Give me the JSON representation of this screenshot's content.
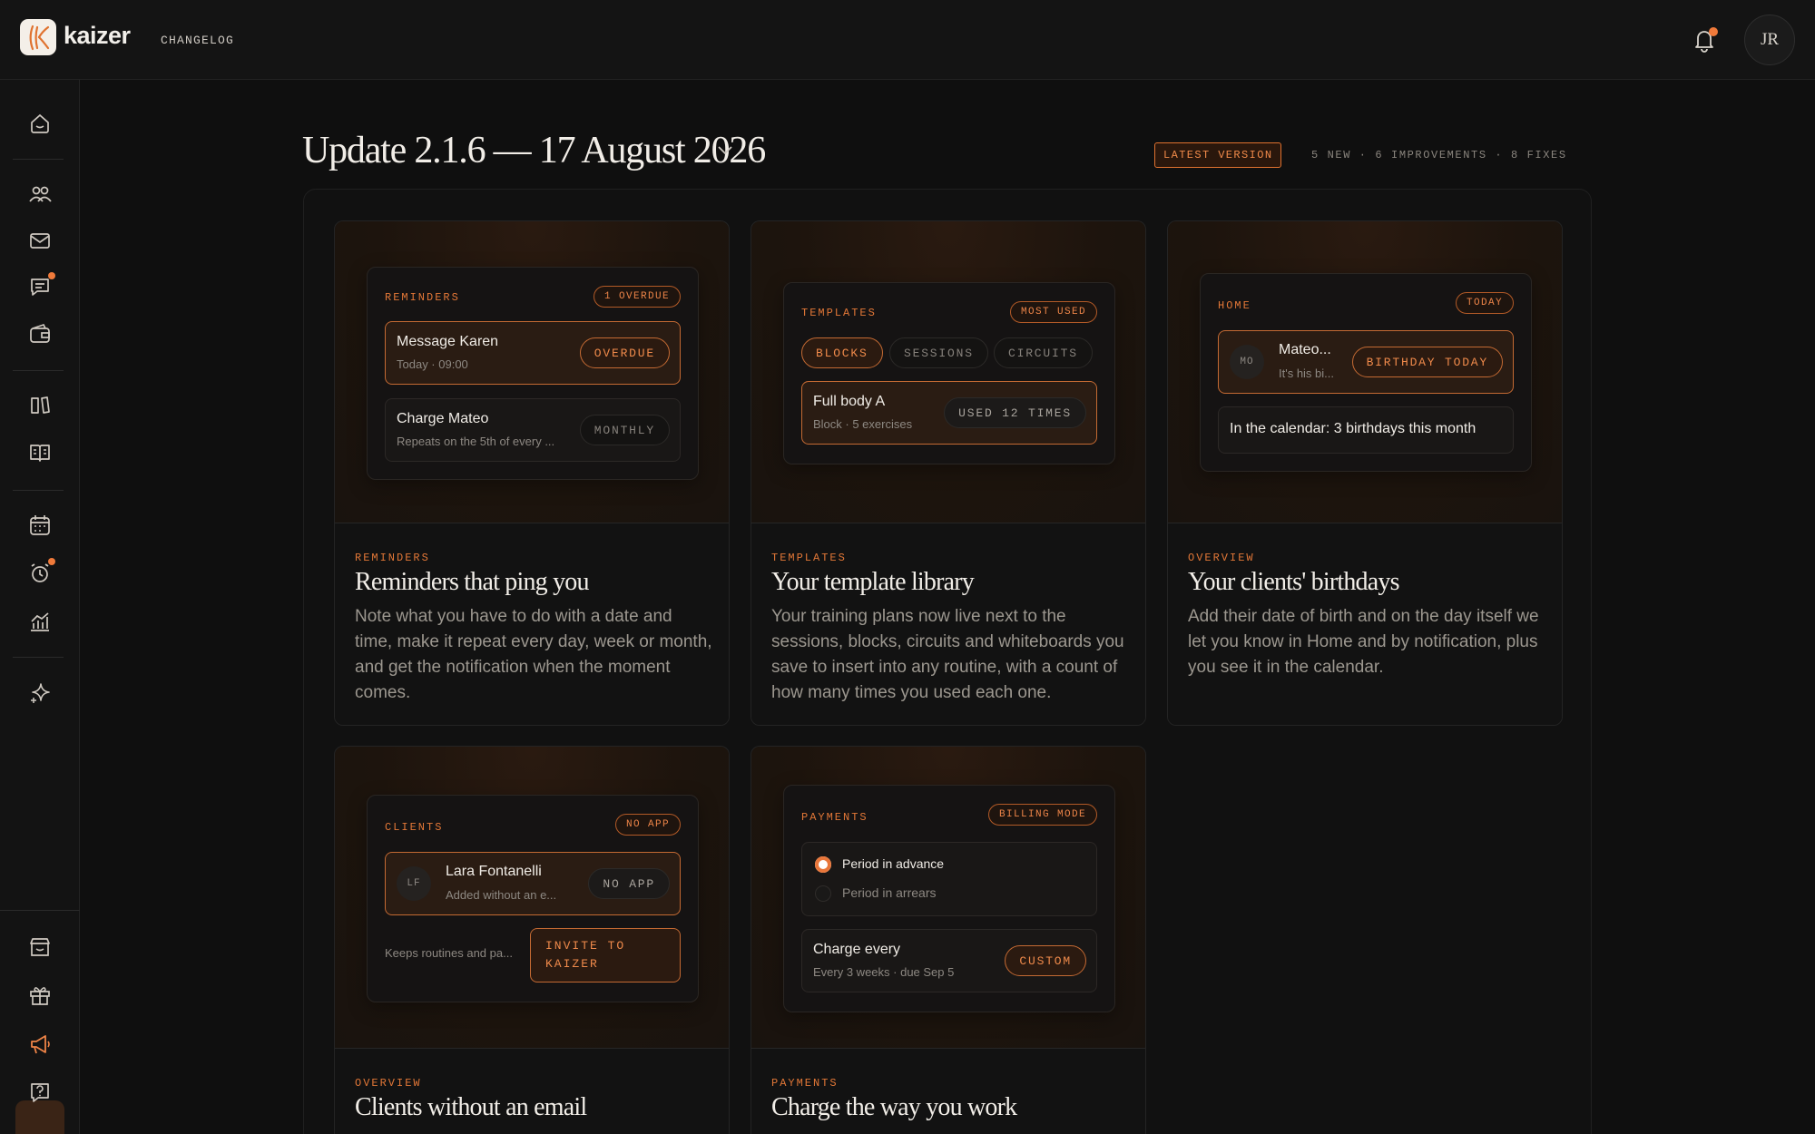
{
  "app": {
    "name": "kaizer",
    "breadcrumb": "CHANGELOG",
    "user_initials": "JR"
  },
  "icons": {
    "sidebar": [
      "home-icon",
      "clients-icon",
      "mail-icon",
      "chat-icon",
      "wallet-icon",
      "library-icon",
      "book-icon",
      "calendar-icon",
      "alarm-icon",
      "stats-icon",
      "sparkle-icon",
      "store-icon",
      "gift-icon",
      "megaphone-icon",
      "help-icon"
    ],
    "top": [
      "bell-icon",
      "chevron-down-icon"
    ]
  },
  "colors": {
    "accent": "#e27737",
    "background": "#0f0f0f",
    "panel": "#151313"
  },
  "header": {
    "title": "Update 2.1.6 — 17 August 2026",
    "latest_badge": "LATEST VERSION",
    "stats": "5 NEW · 6 IMPROVEMENTS · 8 FIXES"
  },
  "cards": [
    {
      "eyebrow": "REMINDERS",
      "title": "Reminders that ping you",
      "description": "Note what you have to do with a date and time, make it repeat every day, week or month, and get the notification when the moment comes.",
      "preview": {
        "label": "REMINDERS",
        "tag": "1 OVERDUE",
        "items": [
          {
            "title": "Message Karen",
            "sub": "Today · 09:00",
            "pill": "OVERDUE"
          },
          {
            "title": "Charge Mateo",
            "sub": "Repeats on the 5th of every ...",
            "pill": "MONTHLY"
          }
        ]
      }
    },
    {
      "eyebrow": "TEMPLATES",
      "title": "Your template library",
      "description": "Your training plans now live next to the sessions, blocks, circuits and whiteboards you save to insert into any routine, with a count of how many times you used each one.",
      "preview": {
        "label": "TEMPLATES",
        "tag": "MOST USED",
        "tabs": [
          "BLOCKS",
          "SESSIONS",
          "CIRCUITS"
        ],
        "item": {
          "title": "Full body A",
          "sub": "Block · 5 exercises",
          "pill": "USED 12 TIMES"
        }
      }
    },
    {
      "eyebrow": "OVERVIEW",
      "title": "Your clients' birthdays",
      "description": "Add their date of birth and on the day itself we let you know in Home and by notification, plus you see it in the calendar.",
      "preview": {
        "label": "HOME",
        "tag": "TODAY",
        "item": {
          "initials": "MO",
          "title": "Mateo...",
          "sub": "It's his bi...",
          "pill": "BIRTHDAY TODAY"
        },
        "note": "In the calendar: 3 birthdays this month"
      }
    },
    {
      "eyebrow": "OVERVIEW",
      "title": "Clients without an email",
      "preview": {
        "label": "CLIENTS",
        "tag": "NO APP",
        "item": {
          "initials": "LF",
          "title": "Lara Fontanelli",
          "sub": "Added without an e...",
          "pill": "NO APP"
        },
        "footer_text": "Keeps routines and pa...",
        "button": "INVITE TO KAIZER"
      }
    },
    {
      "eyebrow": "PAYMENTS",
      "title": "Charge the way you work",
      "preview": {
        "label": "PAYMENTS",
        "tag": "BILLING MODE",
        "options": [
          {
            "label": "Period in advance",
            "selected": true
          },
          {
            "label": "Period in arrears",
            "selected": false
          }
        ],
        "item": {
          "title": "Charge every",
          "sub": "Every 3 weeks · due Sep 5",
          "pill": "CUSTOM"
        }
      }
    }
  ]
}
